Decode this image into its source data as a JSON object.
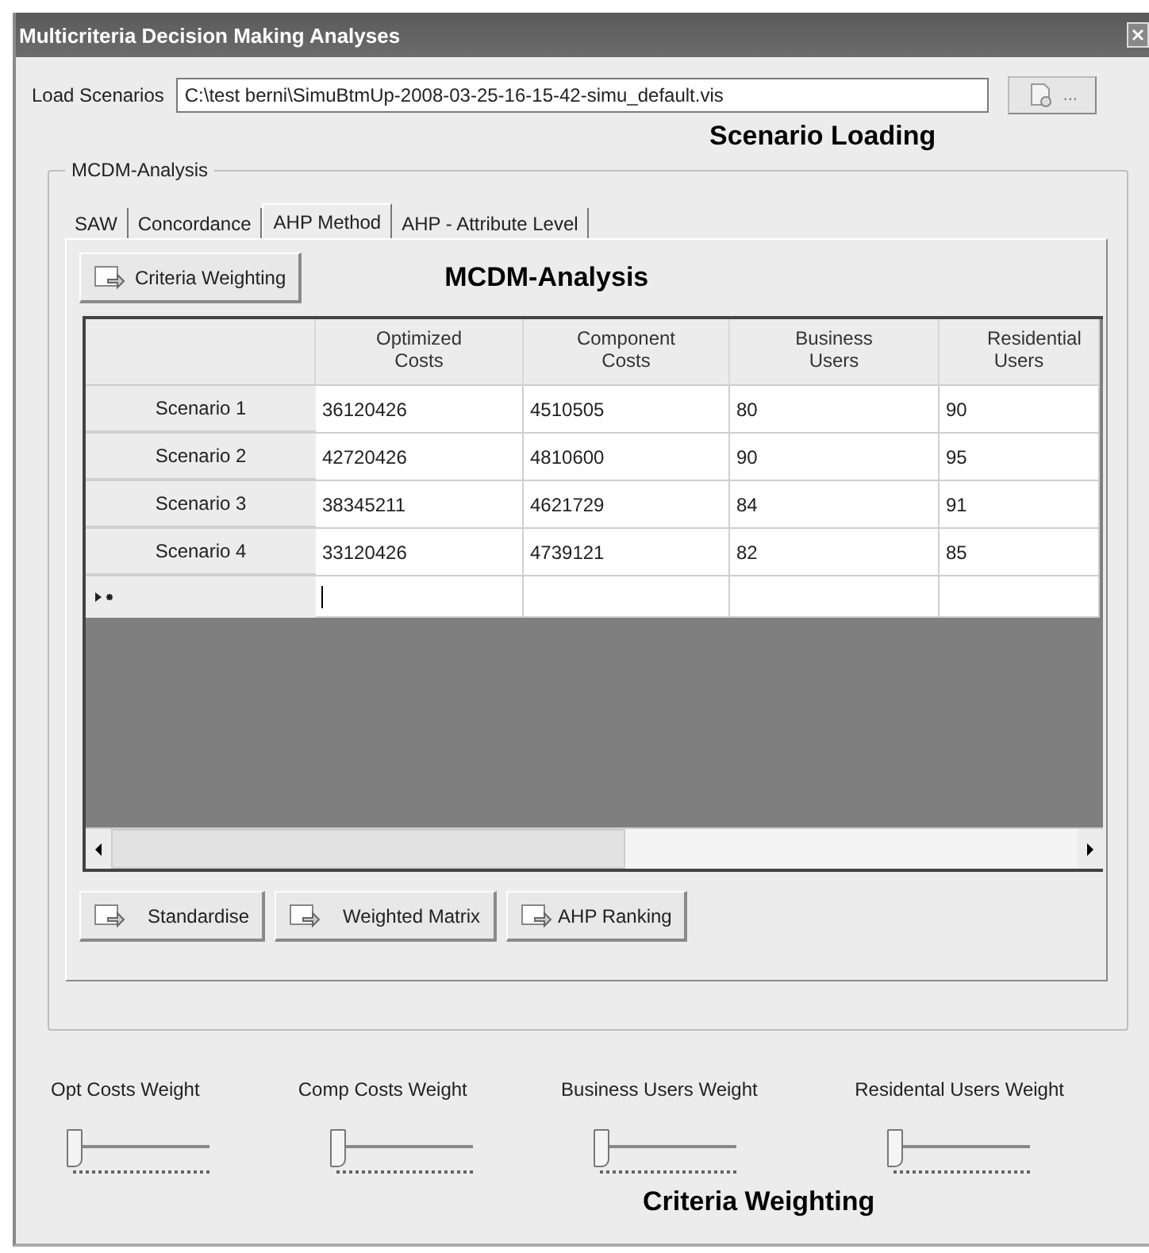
{
  "window": {
    "title": "Multicriteria Decision Making Analyses"
  },
  "load": {
    "label": "Load Scenarios",
    "value": "C:\\test berni\\SimuBtmUp-2008-03-25-16-15-42-simu_default.vis",
    "browse": "...",
    "caption": "Scenario Loading"
  },
  "group": {
    "title": "MCDM-Analysis"
  },
  "tabs": [
    {
      "label": "SAW",
      "selected": false
    },
    {
      "label": "Concordance",
      "selected": false
    },
    {
      "label": "AHP Method",
      "selected": true
    },
    {
      "label": "AHP - Attribute Level",
      "selected": false
    }
  ],
  "criteria_button": "Criteria Weighting",
  "analysis_caption": "MCDM-Analysis",
  "table": {
    "columns": [
      "Optimized Costs",
      "Component Costs",
      "Business Users",
      "Residential Users"
    ],
    "rows": [
      {
        "name": "Scenario 1",
        "cells": [
          "36120426",
          "4510505",
          "80",
          "90"
        ]
      },
      {
        "name": "Scenario 2",
        "cells": [
          "42720426",
          "4810600",
          "90",
          "95"
        ]
      },
      {
        "name": "Scenario 3",
        "cells": [
          "38345211",
          "4621729",
          "84",
          "91"
        ]
      },
      {
        "name": "Scenario 4",
        "cells": [
          "33120426",
          "4739121",
          "82",
          "85"
        ]
      }
    ]
  },
  "actions": [
    "Standardise",
    "Weighted Matrix",
    "AHP Ranking"
  ],
  "weights": [
    {
      "label": "Opt Costs Weight",
      "level": 0
    },
    {
      "label": "Comp Costs Weight",
      "level": 0
    },
    {
      "label": "Business Users Weight",
      "level": 0
    },
    {
      "label": "Residental Users Weight",
      "level": 0
    }
  ],
  "weights_caption": "Criteria Weighting"
}
